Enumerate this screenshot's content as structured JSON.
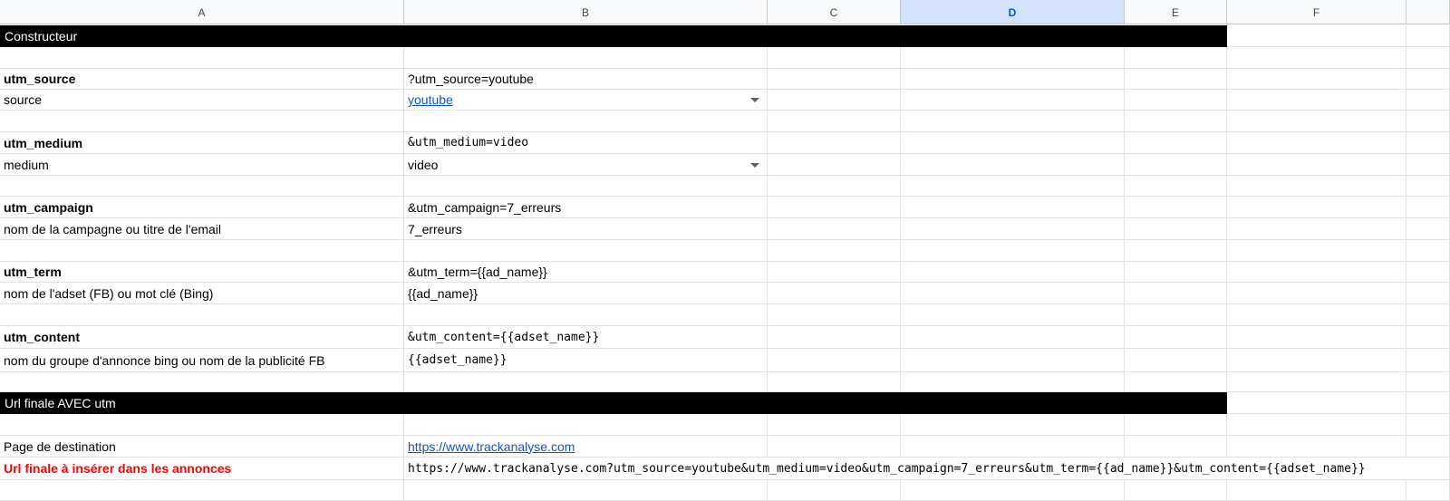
{
  "columns": [
    "A",
    "B",
    "C",
    "D",
    "E",
    "F"
  ],
  "selected_column": "D",
  "rows": {
    "r1_banner": "Constructeur",
    "r3_a": "utm_source",
    "r3_b": "?utm_source=youtube",
    "r4_a": "source",
    "r4_b": "youtube",
    "r6_a": "utm_medium",
    "r6_b": "&utm_medium=video",
    "r7_a": "medium",
    "r7_b": "video",
    "r9_a": "utm_campaign",
    "r9_b": "&utm_campaign=7_erreurs",
    "r10_a": "nom de la campagne ou titre de l'email",
    "r10_b": "7_erreurs",
    "r12_a": "utm_term",
    "r12_b": "&utm_term={{ad_name}}",
    "r13_a": "nom de l'adset (FB) ou mot clé (Bing)",
    "r13_b": "{{ad_name}}",
    "r15_a": "utm_content",
    "r15_b": "&utm_content={{adset_name}}",
    "r16_a": "nom du groupe d'annonce bing ou nom de la publicité FB",
    "r16_b": "{{adset_name}}",
    "r18_banner": "Url finale AVEC utm",
    "r20_a": "Page de destination",
    "r20_b": "https://www.trackanalyse.com",
    "r21_a": "Url finale à insérer dans les annonces",
    "r21_b": "https://www.trackanalyse.com?utm_source=youtube&utm_medium=video&utm_campaign=7_erreurs&utm_term={{ad_name}}&utm_content={{adset_name}}"
  },
  "colors": {
    "banner_bg": "#000000",
    "link": "#1155cc",
    "alert": "#ff0000",
    "selected_header": "#d3e3fd"
  }
}
